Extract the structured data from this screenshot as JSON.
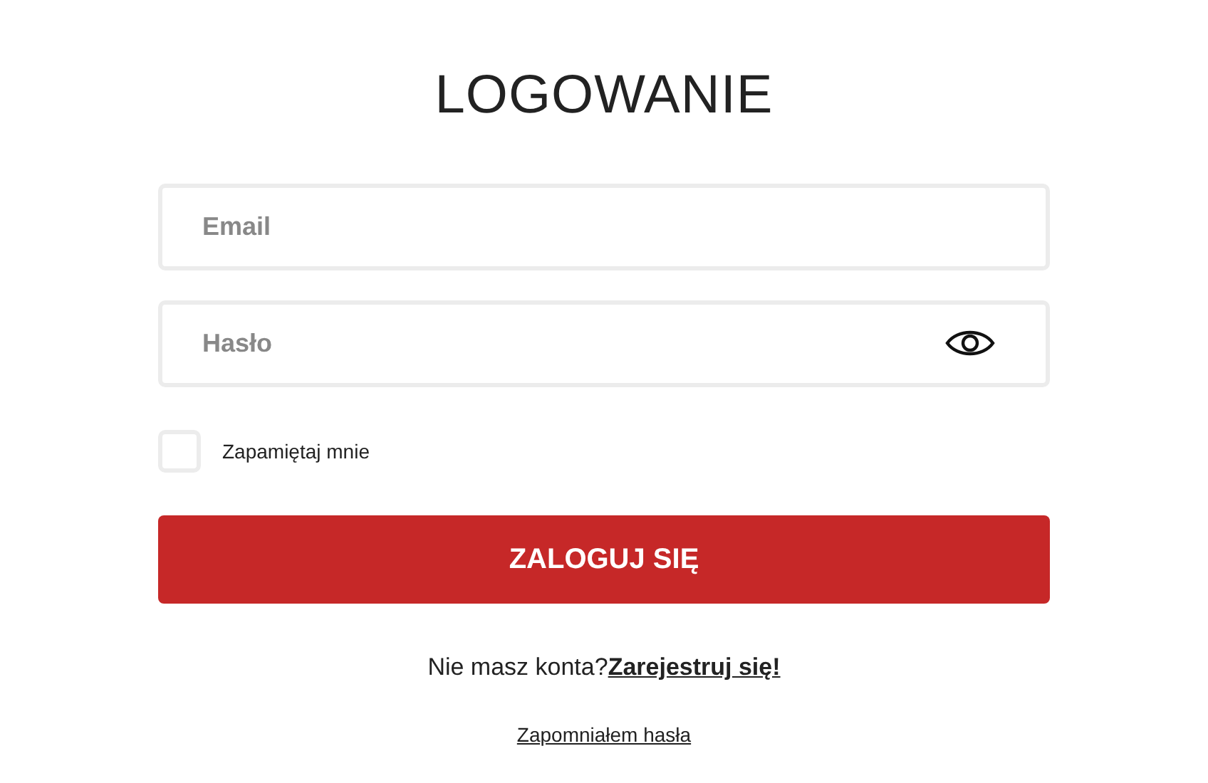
{
  "title": "LOGOWANIE",
  "email": {
    "placeholder": "Email"
  },
  "password": {
    "placeholder": "Hasło"
  },
  "remember": {
    "label": "Zapamiętaj mnie",
    "checked": false
  },
  "submit": {
    "label": "ZALOGUJ SIĘ"
  },
  "register": {
    "text": "Nie masz konta?",
    "link": "Zarejestruj się!"
  },
  "forgot": {
    "label": "Zapomniałem hasła"
  }
}
